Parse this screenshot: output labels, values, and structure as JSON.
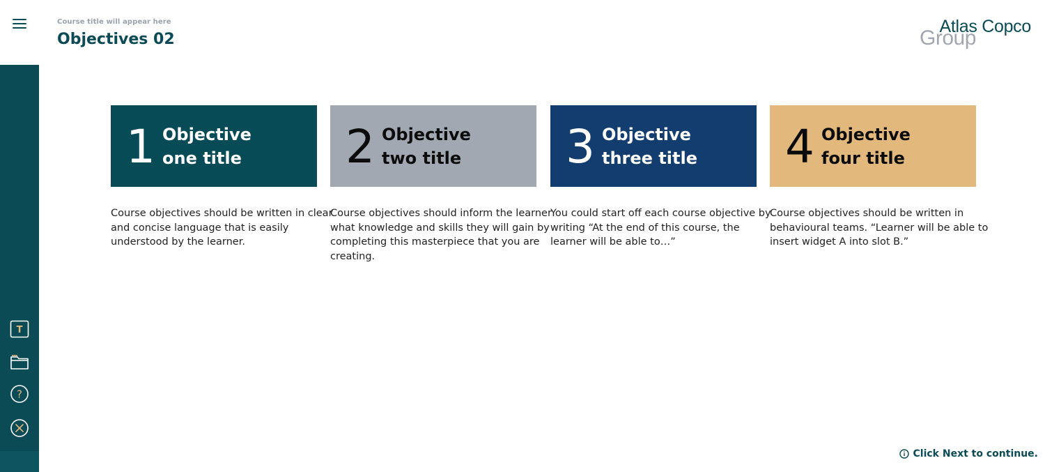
{
  "header": {
    "course_title": "Course title will appear here",
    "page_title": "Objectives 02",
    "logo_line1": "Atlas Copco",
    "logo_line2": "Group"
  },
  "sidebar": {
    "tools": [
      {
        "name": "text-icon",
        "glyph": "T"
      },
      {
        "name": "folder-icon"
      },
      {
        "name": "help-icon",
        "glyph": "?"
      },
      {
        "name": "close-icon"
      }
    ]
  },
  "objectives": [
    {
      "number": "1",
      "title_line1": "Objective",
      "title_line2": "one title",
      "color": "#074b57",
      "text_color": "#ffffff",
      "description": "Course objectives should be written in clear and concise language that is easily understood by the learner."
    },
    {
      "number": "2",
      "title_line1": "Objective",
      "title_line2": "two title",
      "color": "#a1a8b2",
      "text_color": "#0b0b0b",
      "description": "Course objectives should inform the learner what knowledge and skills they will gain by completing this masterpiece that you are creating."
    },
    {
      "number": "3",
      "title_line1": "Objective",
      "title_line2": "three title",
      "color": "#123d6e",
      "text_color": "#ffffff",
      "description": "You could start off each course objective by writing “At the end of  this course, the learner will be able to…”"
    },
    {
      "number": "4",
      "title_line1": "Objective",
      "title_line2": "four title",
      "color": "#e2b87d",
      "text_color": "#0b0b0b",
      "description": "Course objectives should be written in behavioural teams. “Learner will be able to insert widget A into slot B.”"
    }
  ],
  "footer": {
    "hint": "Click Next to continue."
  },
  "colors": {
    "brand_teal": "#0a4b56",
    "accent_gold": "#e2b87d"
  }
}
